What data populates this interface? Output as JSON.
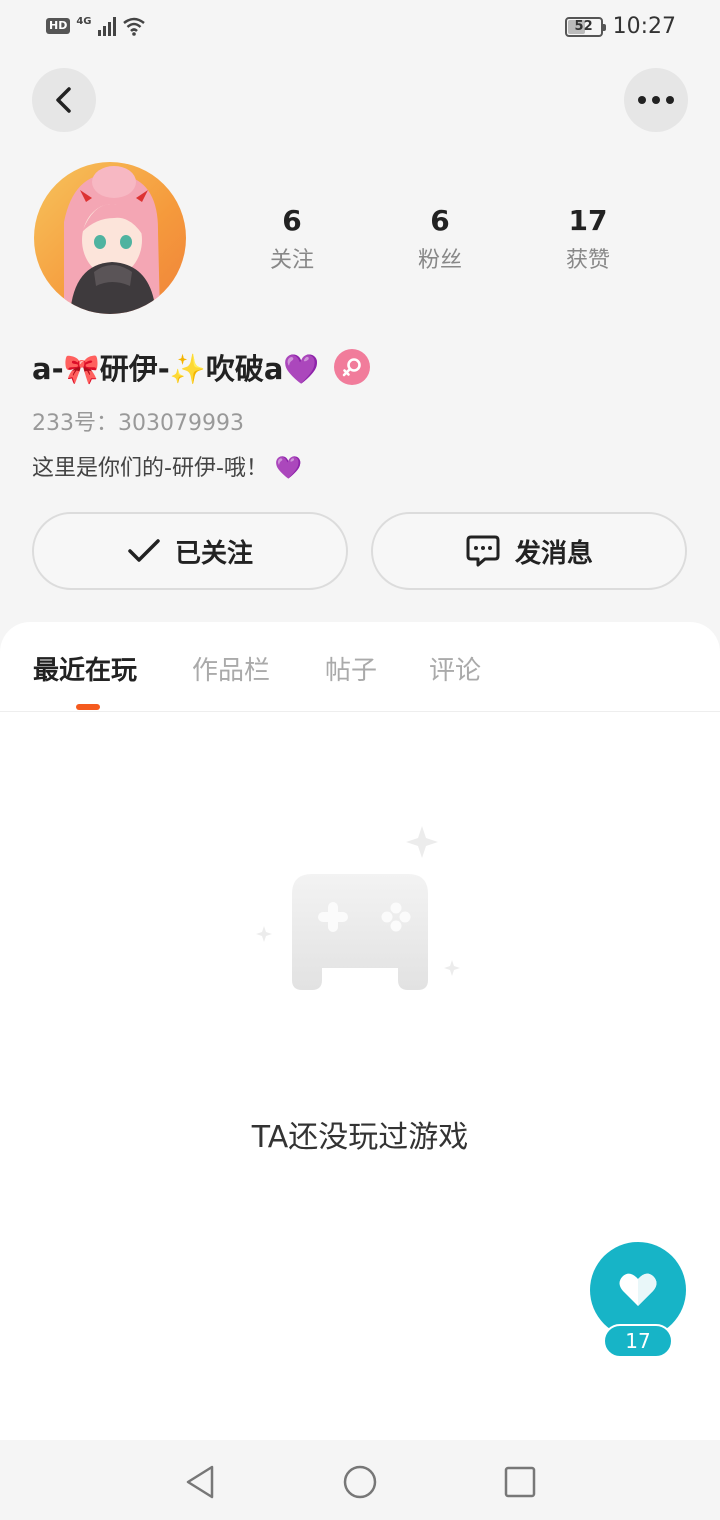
{
  "status_bar": {
    "hd_label": "HD",
    "network_label": "4G",
    "battery_level": "52",
    "battery_fraction": 0.52,
    "time": "10:27"
  },
  "header": {
    "back_icon": "chevron-left-icon",
    "more_icon": "more-dots-icon"
  },
  "profile": {
    "stats": [
      {
        "value": "6",
        "label": "关注"
      },
      {
        "value": "6",
        "label": "粉丝"
      },
      {
        "value": "17",
        "label": "获赞"
      }
    ],
    "nickname": "a-🎀研伊-✨吹破a💜",
    "gender": "female",
    "uid_label": "233号：",
    "uid_value": "303079993",
    "bio": "这里是你们的-研伊-哦！ 💜",
    "follow_label": "已关注",
    "message_label": "发消息"
  },
  "tabs": [
    {
      "label": "最近在玩",
      "active": true
    },
    {
      "label": "作品栏",
      "active": false
    },
    {
      "label": "帖子",
      "active": false
    },
    {
      "label": "评论",
      "active": false
    }
  ],
  "empty_state": {
    "icon": "gamepad-icon",
    "text": "TA还没玩过游戏"
  },
  "like_widget": {
    "count": "17"
  },
  "colors": {
    "accent": "#f55a1e",
    "like": "#17b4c7",
    "gender_female": "#f17c9b"
  }
}
